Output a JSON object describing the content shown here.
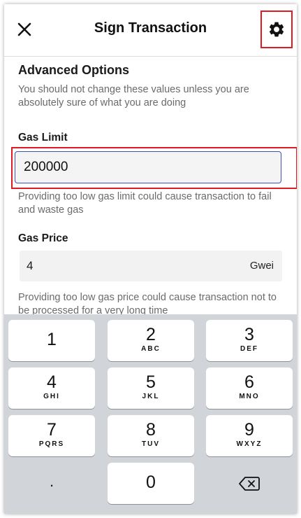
{
  "header": {
    "title": "Sign Transaction"
  },
  "advanced": {
    "title": "Advanced Options",
    "description": "You should not change these values unless you are absolutely sure of what you are doing"
  },
  "gas_limit": {
    "label": "Gas Limit",
    "value": "200000",
    "helper": "Providing too low gas limit could cause transaction to fail and waste gas"
  },
  "gas_price": {
    "label": "Gas Price",
    "value": "4",
    "unit": "Gwei",
    "helper": "Providing too low gas price could cause transaction not to be processed for a very long time"
  },
  "keyboard": {
    "keys": [
      {
        "digit": "1",
        "letters": ""
      },
      {
        "digit": "2",
        "letters": "ABC"
      },
      {
        "digit": "3",
        "letters": "DEF"
      },
      {
        "digit": "4",
        "letters": "GHI"
      },
      {
        "digit": "5",
        "letters": "JKL"
      },
      {
        "digit": "6",
        "letters": "MNO"
      },
      {
        "digit": "7",
        "letters": "PQRS"
      },
      {
        "digit": "8",
        "letters": "TUV"
      },
      {
        "digit": "9",
        "letters": "WXYZ"
      },
      {
        "digit": ".",
        "letters": ""
      },
      {
        "digit": "0",
        "letters": ""
      }
    ]
  },
  "colors": {
    "highlight": "#e01a22",
    "focus_border": "#3f51b5",
    "keyboard_bg": "#d1d4d9"
  }
}
